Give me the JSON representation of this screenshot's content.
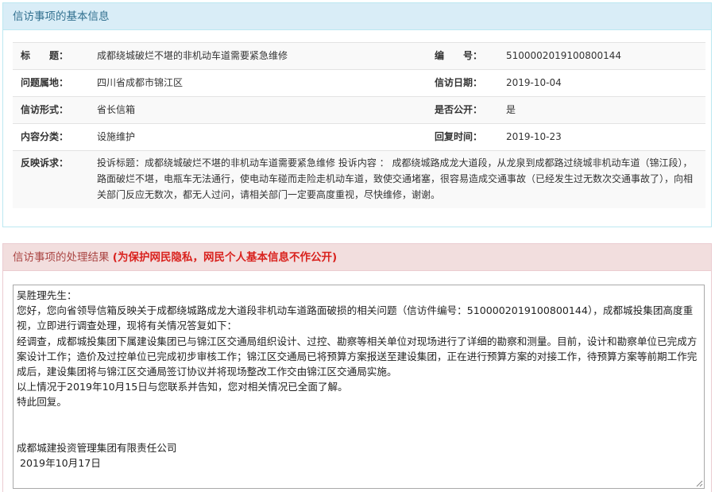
{
  "basic": {
    "heading": "信访事项的基本信息",
    "rows": [
      {
        "l1": "标　　题：",
        "v1": "成都绕城破烂不堪的非机动车道需要紧急维修",
        "l2": "编　　号：",
        "v2": "5100002019100800144"
      },
      {
        "l1": "问题属地：",
        "v1": "四川省成都市锦江区",
        "l2": "信访日期：",
        "v2": "2019-10-04"
      },
      {
        "l1": "信访形式：",
        "v1": "省长信箱",
        "l2": "是否公开：",
        "v2": "是"
      },
      {
        "l1": "内容分类：",
        "v1": "设施维护",
        "l2": "回复时间：",
        "v2": "2019-10-23"
      }
    ],
    "complaint_label": "反映诉求：",
    "complaint_text": "投诉标题：成都绕城破烂不堪的非机动车道需要紧急维修 投诉内容 ： 成都绕城路成龙大道段，从龙泉到成都路过绕城非机动车道（锦江段），路面破烂不堪，电瓶车无法通行，使电动车碰而走险走机动车道，致使交通堵塞，很容易造成交通事故（已经发生过无数次交通事故了），向相关部门反应无数次，都无人过问，请相关部门一定要高度重视，尽快维修，谢谢。"
  },
  "result": {
    "heading": "信访事项的处理结果",
    "heading_note": "(为保护网民隐私，网民个人基本信息不作公开)",
    "reply_lines": [
      "吴胜理先生：",
      "您好，您向省领导信箱反映关于成都绕城路成龙大道段非机动车道路面破损的相关问题（信访件编号：5100002019100800144），成都城投集团高度重视，立即进行调查处理，现将有关情况答复如下：",
      "经调查，成都城投集团下属建设集团已与锦江区交通局组织设计、过控、勘察等相关单位对现场进行了详细的勘察和测量。目前，设计和勘察单位已完成方案设计工作；造价及过控单位已完成初步审核工作；锦江区交通局已将预算方案报送至建设集团，正在进行预算方案的对接工作，待预算方案等前期工作完成后，建设集团将与锦江区交通局签订协议并将现场整改工作交由锦江区交通局实施。",
      "以上情况于2019年10月15日与您联系并告知，您对相关情况已全面了解。",
      "特此回复。",
      "",
      "",
      "成都城建投资管理集团有限责任公司",
      " 2019年10月17日"
    ]
  }
}
